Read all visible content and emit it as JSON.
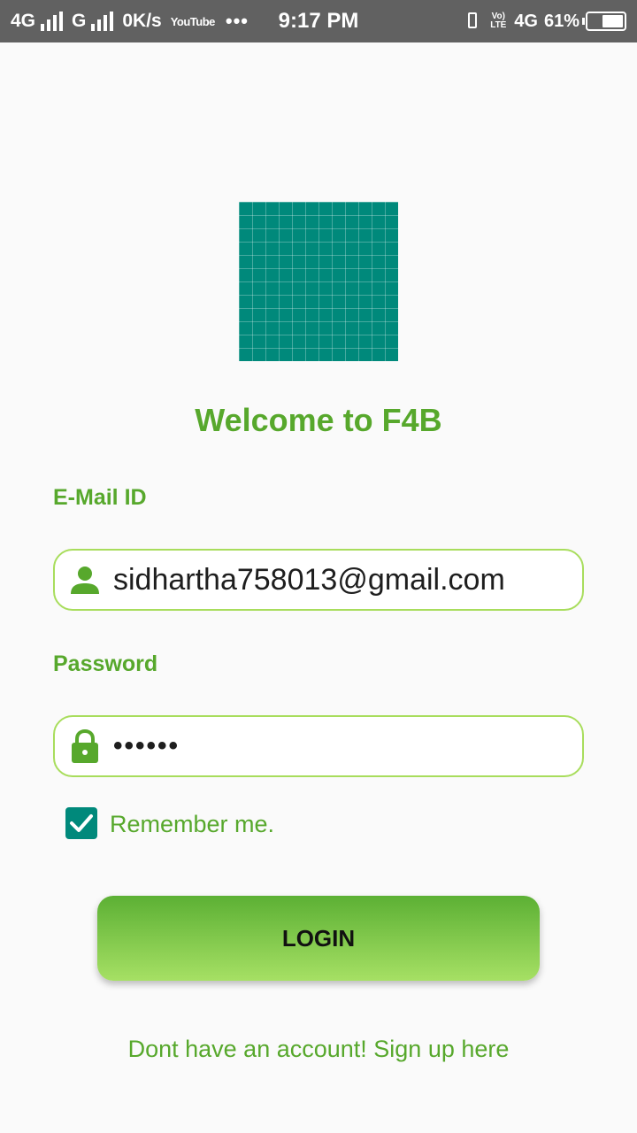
{
  "status_bar": {
    "network1": "4G",
    "network2": "G",
    "speed": "0K/s",
    "youtube": "YouTube",
    "more": "•••",
    "time": "9:17 PM",
    "volte": "Vo) LTE",
    "network3": "4G",
    "battery": "61%",
    "battery_level": 0.61
  },
  "logo": {
    "color": "#00897b"
  },
  "title": "Welcome to F4B",
  "form": {
    "email_label": "E-Mail ID",
    "email_value": "sidhartha758013@gmail.com",
    "email_icon": "person-icon",
    "password_label": "Password",
    "password_value": "••••••",
    "password_icon": "lock-icon",
    "remember_label": "Remember me.",
    "remember_checked": true
  },
  "login_label": "LOGIN",
  "signup_text": "Dont have an account! Sign up here",
  "colors": {
    "accent_green": "#57a82c",
    "border_green": "#a8dd5c",
    "teal": "#00897b",
    "status_bar": "#616161"
  }
}
